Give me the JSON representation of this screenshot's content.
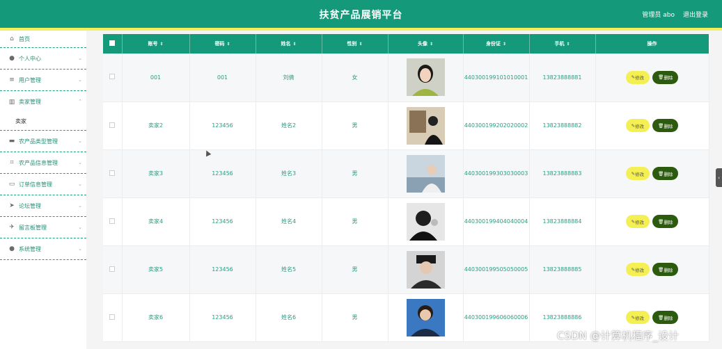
{
  "header": {
    "title": "扶贫产品展销平台",
    "user_label": "管理员 abo",
    "logout_label": "退出登录",
    "bg_color": "#149a7a",
    "accent_color": "#f3ef5e"
  },
  "sidebar": {
    "items": [
      {
        "label": "首页",
        "icon": "home-icon"
      },
      {
        "label": "个人中心",
        "icon": "user-icon"
      },
      {
        "label": "用户管理",
        "icon": "menu-icon"
      },
      {
        "label": "卖家管理",
        "icon": "chart-icon",
        "expanded": true
      },
      {
        "label": "卖家",
        "sub": true
      },
      {
        "label": "农产品类型管理",
        "icon": "box-icon"
      },
      {
        "label": "农产品信息管理",
        "icon": "crop-icon"
      },
      {
        "label": "订单信息管理",
        "icon": "message-icon"
      },
      {
        "label": "论坛管理",
        "icon": "send-icon"
      },
      {
        "label": "留言板管理",
        "icon": "plane-icon"
      },
      {
        "label": "系统管理",
        "icon": "user-icon"
      }
    ]
  },
  "table": {
    "columns": [
      "账号",
      "密码",
      "姓名",
      "性别",
      "头像",
      "身份证",
      "手机",
      "操作"
    ],
    "edit_label": "修改",
    "delete_label": "删除",
    "rows": [
      {
        "account": "001",
        "password": "001",
        "name": "刘倩",
        "gender": "女",
        "id_card": "440300199101010001",
        "phone": "13823888881"
      },
      {
        "account": "卖家2",
        "password": "123456",
        "name": "姓名2",
        "gender": "男",
        "id_card": "440300199202020002",
        "phone": "13823888882"
      },
      {
        "account": "卖家3",
        "password": "123456",
        "name": "姓名3",
        "gender": "男",
        "id_card": "440300199303030003",
        "phone": "13823888883"
      },
      {
        "account": "卖家4",
        "password": "123456",
        "name": "姓名4",
        "gender": "男",
        "id_card": "440300199404040004",
        "phone": "13823888884"
      },
      {
        "account": "卖家5",
        "password": "123456",
        "name": "姓名5",
        "gender": "男",
        "id_card": "440300199505050005",
        "phone": "13823888885"
      },
      {
        "account": "卖家6",
        "password": "123456",
        "name": "姓名6",
        "gender": "男",
        "id_card": "440300199606060006",
        "phone": "13823888886"
      }
    ]
  },
  "watermark": "CSDN @计算机程序_设计"
}
